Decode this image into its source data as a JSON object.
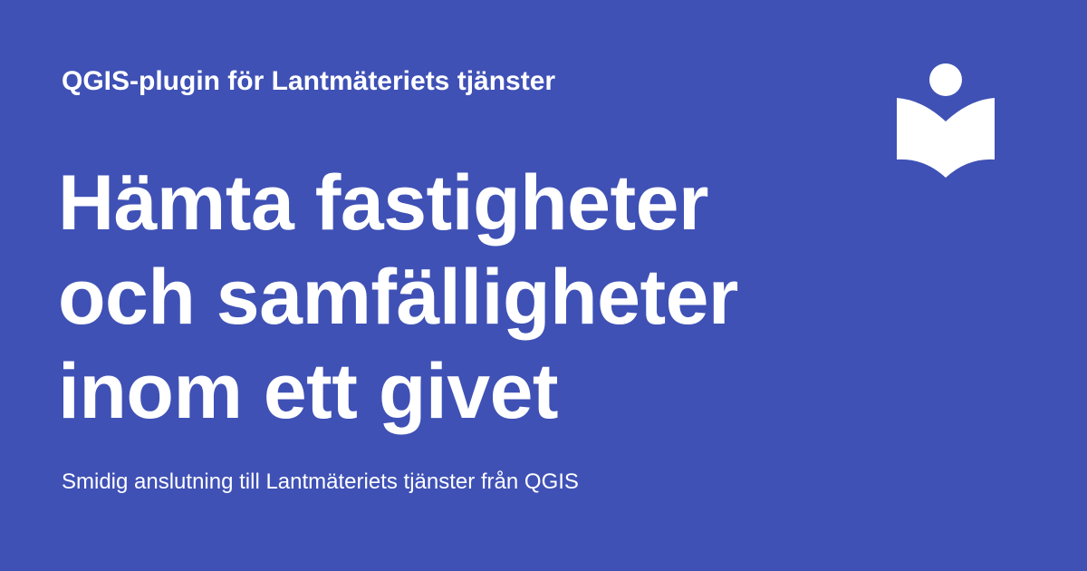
{
  "header": {
    "kicker": "QGIS-plugin för Lantmäteriets tjänster"
  },
  "main": {
    "title_lines": [
      "Hämta fastigheter",
      "och samfälligheter",
      "inom ett givet"
    ],
    "subtitle": "Smidig anslutning till Lantmäteriets tjänster från QGIS"
  },
  "logo": {
    "icon": "reader-book-icon"
  },
  "colors": {
    "background": "#3f51b5",
    "text": "#ffffff"
  }
}
